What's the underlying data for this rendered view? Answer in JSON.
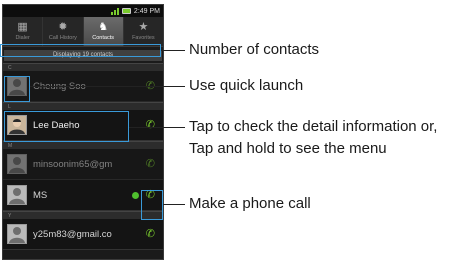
{
  "phone": {
    "status_time": "2:49 PM",
    "tabs": [
      {
        "label": "Dialer",
        "icon": "dialpad-icon"
      },
      {
        "label": "Call History",
        "icon": "call-history-icon"
      },
      {
        "label": "Contacts",
        "icon": "contacts-icon"
      },
      {
        "label": "Favorites",
        "icon": "star-icon"
      }
    ],
    "count_text": "Displaying 19 contacts",
    "sections": [
      "C",
      "L",
      "M",
      "Y"
    ],
    "contacts": [
      {
        "name": "Cheung Soo"
      },
      {
        "name": "Lee Daeho"
      },
      {
        "name": "minsoonim65@gm"
      },
      {
        "name": "MS"
      },
      {
        "name": "y25m83@gmail.co"
      }
    ]
  },
  "callouts": {
    "count": "Number of contacts",
    "quick_launch": "Use quick launch",
    "detail_line1": "Tap to check the detail information or,",
    "detail_line2": "Tap and hold to see the menu",
    "call": "Make a phone call"
  },
  "colors": {
    "highlight": "#3a9ad9",
    "call_icon": "#7acb2d"
  }
}
